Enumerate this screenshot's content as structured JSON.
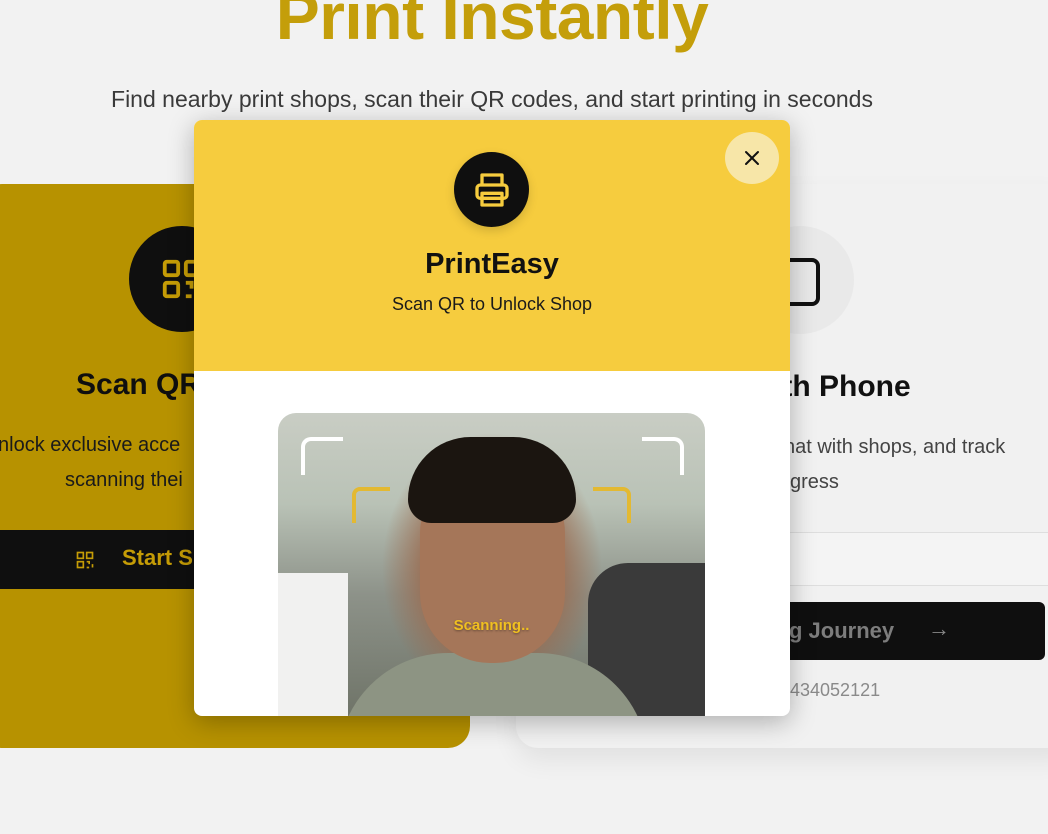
{
  "hero": {
    "title": "Print Instantly",
    "subtitle": "Find nearby print shops, scan their QR codes, and start printing in seconds"
  },
  "left_card": {
    "title": "Scan QR",
    "description_line1": "nlock exclusive acce",
    "description_line2": "scanning thei",
    "button_label": "Start S"
  },
  "right_card": {
    "title": "ith Phone",
    "description_line1": "hat with shops, and track",
    "description_line2": "gress",
    "button_label": "g Journey",
    "phone_text": "434052121"
  },
  "modal": {
    "brand": "PrintEasy",
    "tagline": "Scan QR to Unlock Shop",
    "scan_status": "Scanning..",
    "icons": {
      "close": "close-icon",
      "printer": "printer-icon"
    }
  },
  "colors": {
    "accent_yellow": "#f6cc3e",
    "hero_gold": "#c49e0a",
    "card_gold": "#b79200",
    "dark": "#0f0f0f"
  }
}
